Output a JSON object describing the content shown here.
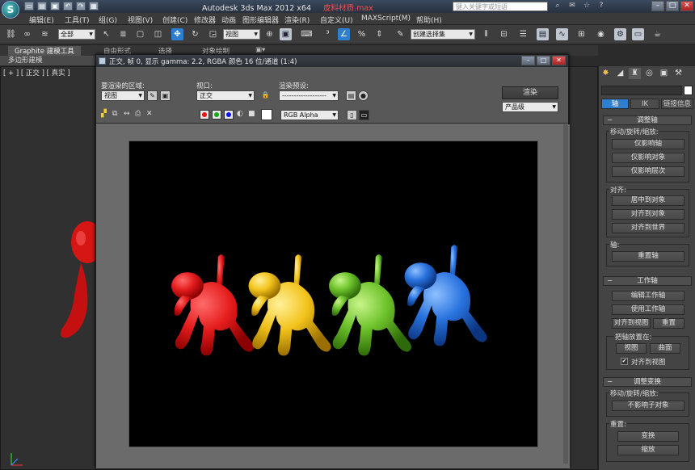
{
  "titlebar": {
    "app_name": "Autodesk 3ds Max  2012 x64",
    "file_name": "皮料材质.max",
    "search_placeholder": "键入关键字或短语"
  },
  "menu": [
    "编辑(E)",
    "工具(T)",
    "组(G)",
    "视图(V)",
    "创建(C)",
    "修改器",
    "动画",
    "图形编辑器",
    "渲染(R)",
    "自定义(U)",
    "MAXScript(M)",
    "帮助(H)"
  ],
  "toolbar": {
    "selection_filter": "全部",
    "reference_coord": "视图",
    "named_selection": "创建选择集"
  },
  "ribbon": {
    "tabs": [
      "Graphite 建模工具",
      "自由形式",
      "选择",
      "对象绘制"
    ],
    "sub_label": "多边形建模"
  },
  "viewport": {
    "label": "[ + ] [ 正交 ] [ 真实 ]"
  },
  "render_dialog": {
    "title": "正交, 帧 0, 显示 gamma: 2.2, RGBA 颜色 16 位/通道 (1:4)",
    "area_label": "要渲染的区域:",
    "area_value": "视图",
    "viewport_label": "视口:",
    "viewport_value": "正交",
    "preset_label": "渲染预设:",
    "preset_value": "-------------------",
    "render_button": "渲染",
    "quality_value": "产品级",
    "channel_value": "RGB Alpha"
  },
  "command_panel": {
    "tabs": [
      "轴",
      "IK",
      "链接信息"
    ],
    "rollouts": {
      "adjust_pivot": {
        "header": "调整轴",
        "move_label": "移动/旋转/缩放:",
        "btn1": "仅影响轴",
        "btn2": "仅影响对象",
        "btn3": "仅影响层次",
        "align_label": "对齐:",
        "btn4": "居中到对象",
        "btn5": "对齐到对象",
        "btn6": "对齐到世界",
        "pivot_label": "轴:",
        "btn7": "重置轴"
      },
      "working_pivot": {
        "header": "工作轴",
        "btn1": "编辑工作轴",
        "btn2": "使用工作轴",
        "btn3": "对齐到视图",
        "btn4": "重置",
        "place_label": "把轴放置在:",
        "btn5": "视图",
        "btn6": "曲面",
        "check_label": "对齐到视图"
      },
      "adjust_transform": {
        "header": "调整变换",
        "move_label": "移动/旋转/缩放:",
        "btn1": "不影响子对象",
        "reset_label": "重置:",
        "btn2": "变换",
        "btn3": "缩放"
      }
    }
  },
  "colors": {
    "accent_blue": "#2f7fd0",
    "dog_red": "#e51d1d",
    "dog_yellow": "#f2c31b",
    "dog_green": "#6cc12a",
    "dog_blue": "#2872de",
    "render_bg": "#000000"
  },
  "icons": [
    "app-logo-icon",
    "link-icon",
    "unlink-icon",
    "select-icon",
    "move-icon",
    "rotate-icon",
    "scale-icon",
    "snap-icon",
    "mirror-icon",
    "align-icon",
    "render-icon",
    "teapot-icon",
    "create-tab-icon",
    "modify-tab-icon",
    "hierarchy-tab-icon",
    "motion-tab-icon",
    "display-tab-icon",
    "utilities-tab-icon"
  ]
}
